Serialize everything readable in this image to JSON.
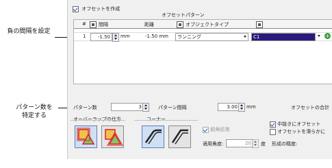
{
  "callouts": {
    "spacing": "負の間隔を設定",
    "pattern_count_line1": "パターン数を",
    "pattern_count_line2": "特定する"
  },
  "header": {
    "create_offset_label": "オフセットを作成",
    "pattern_title": "オフセットパターン"
  },
  "table": {
    "columns": [
      "#",
      "間隔",
      "距離",
      "オブジェクトタイプ"
    ],
    "rows": [
      {
        "index": "1",
        "spacing": "-1.50",
        "spacing_unit": "mm",
        "distance": "-1.50 mm",
        "object_type": "ランニング",
        "color": "C1"
      }
    ]
  },
  "pattern": {
    "count_label": "パターン数",
    "count_value": "3",
    "spacing_label": "パターン間隔",
    "spacing_value": "3.00",
    "spacing_unit": "mm",
    "total_label": "オフセットの合計"
  },
  "overlap": {
    "label": "オーバーラップの仕方"
  },
  "corner": {
    "label": "コーナー",
    "bevel_label": "鋭角処理",
    "angle_label": "適用角度:",
    "angle_value": "20",
    "angle_unit": "度"
  },
  "options": {
    "hollow_label": "中抜きにオフセット",
    "smooth_label": "オフセットを滑らかに",
    "precision_label": "形成の精度:"
  },
  "colors": {
    "color_swatch": "#2a1a7a",
    "accent": "#1a4fb5"
  }
}
